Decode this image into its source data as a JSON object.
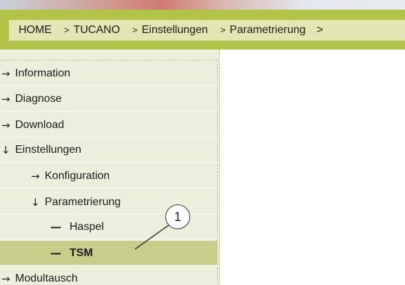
{
  "breadcrumb": {
    "home": "HOME",
    "separator": ">",
    "items": [
      "TUCANO",
      "Einstellungen",
      "Parametrierung"
    ],
    "tail": ">"
  },
  "sidebar": {
    "items": [
      {
        "icon": "arrow-right-icon",
        "glyph": "→",
        "label": "Information"
      },
      {
        "icon": "arrow-right-icon",
        "glyph": "→",
        "label": "Diagnose"
      },
      {
        "icon": "arrow-right-icon",
        "glyph": "→",
        "label": "Download"
      },
      {
        "icon": "arrow-down-icon",
        "glyph": "↓",
        "label": "Einstellungen"
      },
      {
        "icon": "arrow-right-icon",
        "glyph": "→",
        "label": "Konfiguration"
      },
      {
        "icon": "arrow-down-icon",
        "glyph": "↓",
        "label": "Parametrierung"
      },
      {
        "icon": "dash-icon",
        "glyph": "—",
        "label": "Haspel"
      },
      {
        "icon": "dash-icon",
        "glyph": "—",
        "label": "TSM",
        "active": true
      },
      {
        "icon": "arrow-right-icon",
        "glyph": "→",
        "label": "Modultausch"
      }
    ]
  },
  "callout": {
    "number": "1"
  },
  "colors": {
    "breadcrumb_bar": "#b2c349",
    "breadcrumb_inner": "#e1e6b4",
    "sidebar_bg": "#ecefdc",
    "active_item": "#c8cd8a"
  }
}
